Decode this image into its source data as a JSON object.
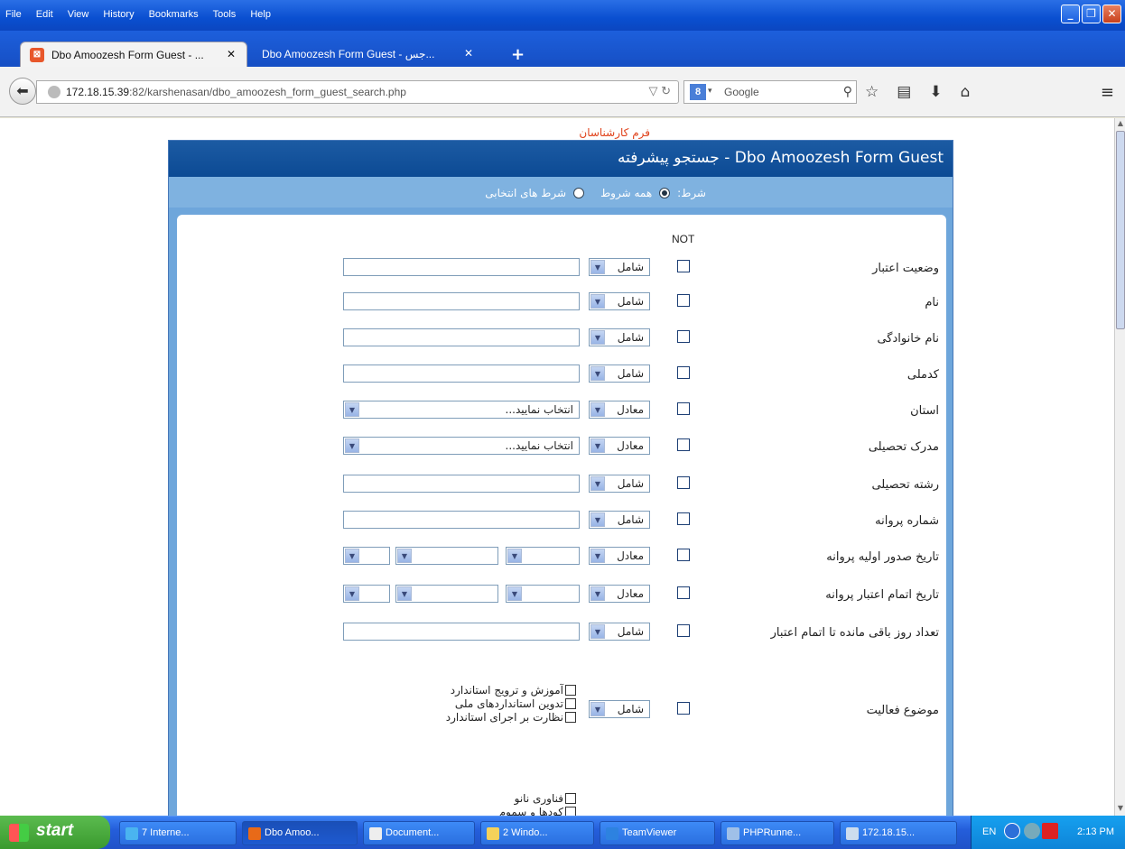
{
  "browser": {
    "menus": [
      "File",
      "Edit",
      "View",
      "History",
      "Bookmarks",
      "Tools",
      "Help"
    ],
    "tabs": [
      {
        "label": "Dbo Amoozesh Form Guest - ...",
        "active": true
      },
      {
        "label": "Dbo Amoozesh Form Guest - جس...",
        "active": false
      }
    ],
    "url_host": "172.18.15.39",
    "url_path": ":82/karshenasan/dbo_amoozesh_form_guest_search.php",
    "search_placeholder": "Google"
  },
  "page": {
    "top_title": "فرم کارشناسان",
    "panel_title": "Dbo Amoozesh Form Guest - جستجو پیشرفته",
    "cond_label": "شرط:",
    "cond_all": "همه شروط",
    "cond_any": "شرط های انتخابی",
    "not_header": "NOT",
    "fields": [
      {
        "label": "وضعیت اعتبار",
        "op": "شامل",
        "type": "text"
      },
      {
        "label": "نام",
        "op": "شامل",
        "type": "text"
      },
      {
        "label": "نام خانوادگی",
        "op": "شامل",
        "type": "text"
      },
      {
        "label": "کدملی",
        "op": "شامل",
        "type": "text"
      },
      {
        "label": "استان",
        "op": "معادل",
        "type": "select",
        "value": "انتخاب نمایید..."
      },
      {
        "label": "مدرک تحصیلی",
        "op": "معادل",
        "type": "select",
        "value": "انتخاب نمایید..."
      },
      {
        "label": "رشته تحصیلی",
        "op": "شامل",
        "type": "text"
      },
      {
        "label": "شماره پروانه",
        "op": "شامل",
        "type": "text"
      },
      {
        "label": "تاریخ صدور اولیه پروانه",
        "op": "معادل",
        "type": "date"
      },
      {
        "label": "تاریخ اتمام اعتبار پروانه",
        "op": "معادل",
        "type": "date"
      },
      {
        "label": "تعداد روز باقی مانده تا اتمام اعتبار",
        "op": "شامل",
        "type": "text"
      },
      {
        "label": "موضوع فعالیت",
        "op": "شامل",
        "type": "checklist"
      }
    ],
    "activity_options": [
      "آموزش و ترویج استاندارد",
      "تدوین استانداردهای ملی",
      "نظارت بر اجرای استاندارد"
    ],
    "extra_options": [
      "فناوری نانو",
      "کودها و سموم"
    ]
  },
  "taskbar": {
    "start": "start",
    "items": [
      "7 Interne...",
      "Dbo Amoo...",
      "Document...",
      "2 Windo...",
      "TeamViewer",
      "PHPRunne...",
      "172.18.15..."
    ],
    "lang": "EN",
    "time": "2:13 PM"
  }
}
